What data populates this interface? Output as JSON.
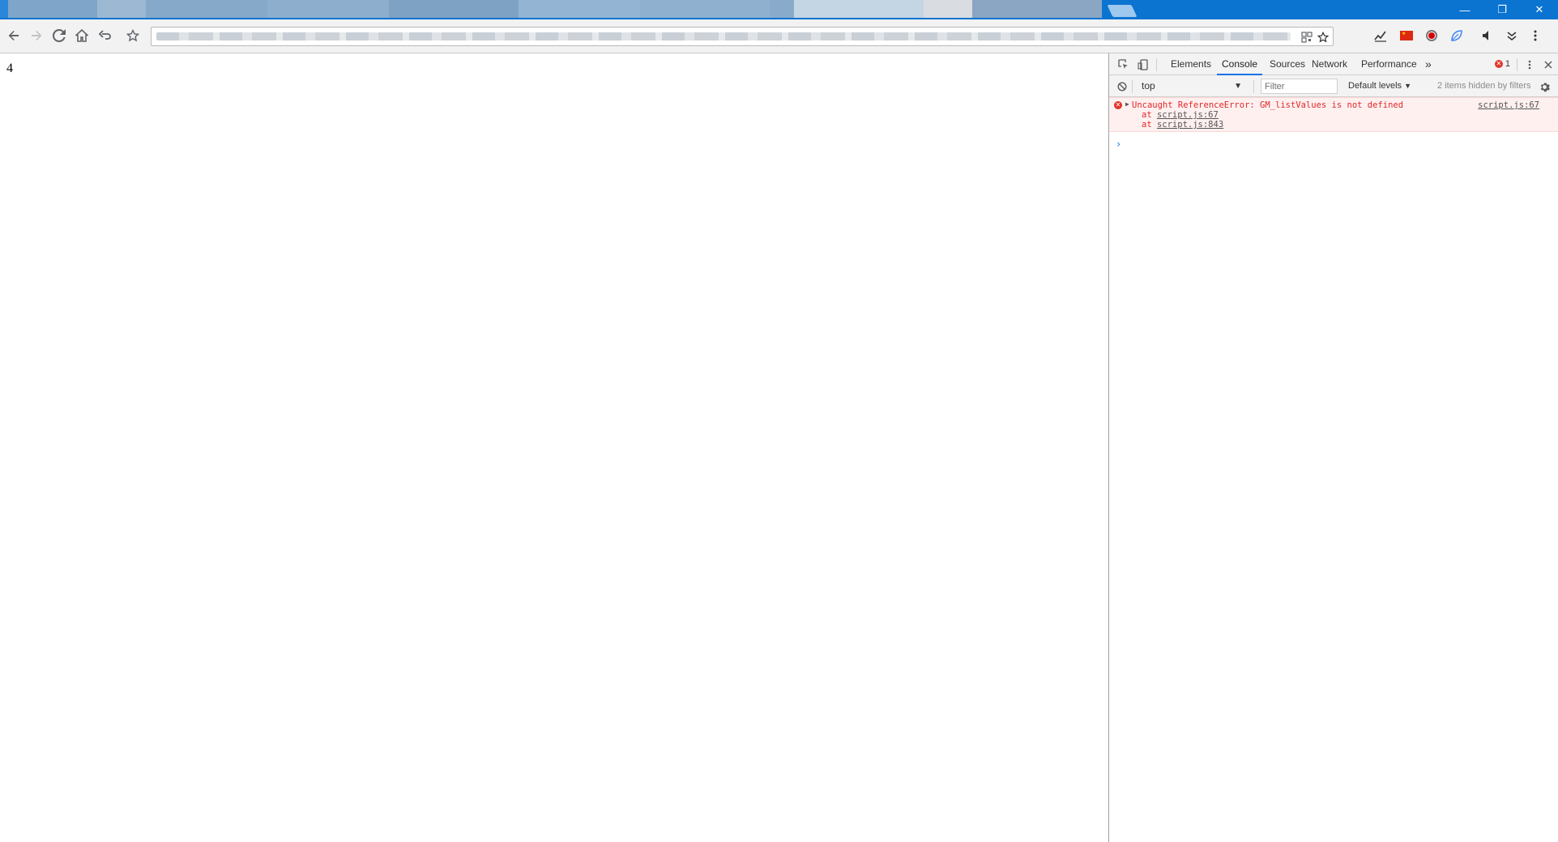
{
  "page": {
    "body_text": "4"
  },
  "window": {
    "minimize": "—",
    "restore": "❐",
    "close": "✕"
  },
  "devtools": {
    "tabs": [
      "Elements",
      "Console",
      "Sources",
      "Network",
      "Performance"
    ],
    "active_tab": "Console",
    "more_tabs": "»",
    "error_count": "1",
    "console_toolbar": {
      "context": "top",
      "filter_placeholder": "Filter",
      "levels": "Default levels",
      "hidden_note": "2 items hidden by filters"
    },
    "messages": [
      {
        "level": "error",
        "text": "Uncaught ReferenceError: GM_listValues is not defined",
        "source": "script.js:67",
        "stack": [
          {
            "prefix": "at ",
            "link": "script.js:67"
          },
          {
            "prefix": "at ",
            "link": "script.js:843"
          }
        ]
      }
    ],
    "prompt": "›"
  },
  "colors": {
    "titlebar": "#0b74d1",
    "error_text": "#e02828",
    "error_bg": "#fff0f0",
    "accent": "#1a73e8"
  }
}
